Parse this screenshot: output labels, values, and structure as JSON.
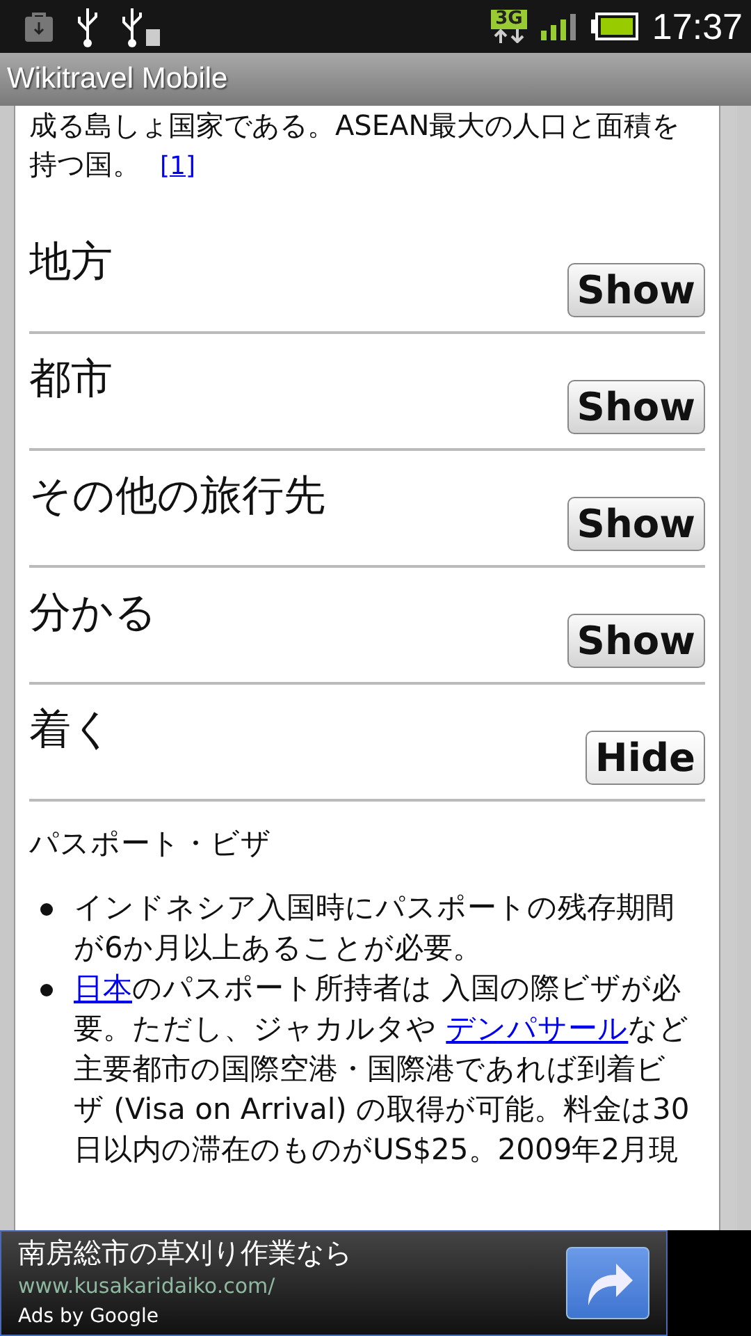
{
  "status_bar": {
    "network": "3G",
    "time": "17:37"
  },
  "app_bar": {
    "title": "Wikitravel Mobile"
  },
  "intro": {
    "text": "成る島しょ国家である。ASEAN最大の人口と面積を持つ国。",
    "ref_link": "[1]"
  },
  "sections": [
    {
      "title": "地方",
      "button": "Show",
      "expanded": false
    },
    {
      "title": "都市",
      "button": "Show",
      "expanded": false
    },
    {
      "title": "その他の旅行先",
      "button": "Show",
      "expanded": false
    },
    {
      "title": "分かる",
      "button": "Show",
      "expanded": false
    },
    {
      "title": "着く",
      "button": "Hide",
      "expanded": true
    }
  ],
  "subsection": {
    "title": "パスポート・ビザ",
    "bullets": [
      [
        {
          "text": "インドネシア入国時にパスポートの残存期間が6か月以上あることが必要。"
        }
      ],
      [
        {
          "text": "日本",
          "link": true
        },
        {
          "text": "のパスポート所持者は 入国の際ビザが必要。ただし、ジャカルタや "
        },
        {
          "text": "デンパサール",
          "link": true
        },
        {
          "text": "など主要都市の国際空港・国際港であれば到着ビザ (Visa on Arrival) の取得が可能。料金は30日以内の滞在のものがUS$25。2009年2月現"
        }
      ]
    ]
  },
  "ad": {
    "headline": "南房総市の草刈り作業なら",
    "url": "www.kusakaridaiko.com/",
    "attribution": "Ads by Google"
  }
}
